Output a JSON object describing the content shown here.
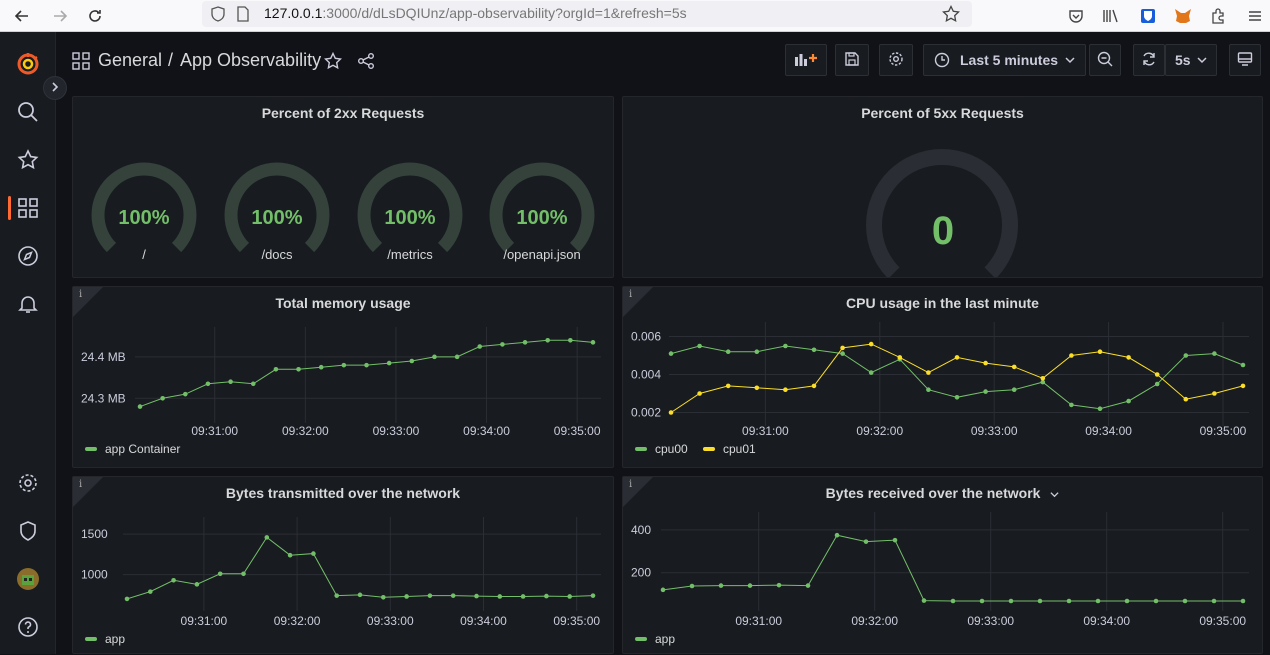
{
  "browser": {
    "url_scheme_host": "127.0.0.1",
    "url_rest": ":3000/d/dLsDQIUnz/app-observability?orgId=1&refresh=5s"
  },
  "header": {
    "folder": "General",
    "separator": "/",
    "title": "App Observability",
    "time_range": "Last 5 minutes",
    "refresh_interval": "5s"
  },
  "colors": {
    "green": "#73bf69",
    "yellow": "#fade2a",
    "accent": "#ff6a33"
  },
  "panels": {
    "p2xx": {
      "title": "Percent of 2xx Requests",
      "gauges": [
        {
          "value": "100%",
          "label": "/",
          "fraction": 1.0
        },
        {
          "value": "100%",
          "label": "/docs",
          "fraction": 1.0
        },
        {
          "value": "100%",
          "label": "/metrics",
          "fraction": 1.0
        },
        {
          "value": "100%",
          "label": "/openapi.json",
          "fraction": 1.0
        }
      ]
    },
    "p5xx": {
      "title": "Percent of 5xx Requests",
      "gauge": {
        "value": "0",
        "fraction": 0.0
      }
    },
    "memory": {
      "title": "Total memory usage",
      "info": "i"
    },
    "cpu": {
      "title": "CPU usage in the last minute",
      "info": "i"
    },
    "tx": {
      "title": "Bytes transmitted over the network",
      "info": "i"
    },
    "rx": {
      "title": "Bytes received over the network",
      "info": "i"
    }
  },
  "chart_data": [
    {
      "id": "memory",
      "type": "line",
      "title": "Total memory usage",
      "x_ticks": [
        "09:31:00",
        "09:32:00",
        "09:33:00",
        "09:34:00",
        "09:35:00"
      ],
      "y_ticks": [
        "24.3 MB",
        "24.4 MB"
      ],
      "ylim": [
        24.25,
        24.46
      ],
      "series": [
        {
          "name": "app Container",
          "color": "#73bf69",
          "values": [
            24.28,
            24.3,
            24.31,
            24.335,
            24.34,
            24.335,
            24.37,
            24.37,
            24.375,
            24.38,
            24.38,
            24.385,
            24.39,
            24.4,
            24.4,
            24.425,
            24.43,
            24.435,
            24.44,
            24.44,
            24.435
          ]
        }
      ]
    },
    {
      "id": "cpu",
      "type": "line",
      "title": "CPU usage in the last minute",
      "x_ticks": [
        "09:31:00",
        "09:32:00",
        "09:33:00",
        "09:34:00",
        "09:35:00"
      ],
      "y_ticks": [
        "0.002",
        "0.004",
        "0.006"
      ],
      "ylim": [
        0.0015,
        0.0065
      ],
      "series": [
        {
          "name": "cpu00",
          "color": "#73bf69",
          "values": [
            0.0051,
            0.0055,
            0.0052,
            0.0052,
            0.0055,
            0.0053,
            0.0051,
            0.0041,
            0.0048,
            0.0032,
            0.0028,
            0.0031,
            0.0032,
            0.0036,
            0.0024,
            0.0022,
            0.0026,
            0.0035,
            0.005,
            0.0051,
            0.0045
          ]
        },
        {
          "name": "cpu01",
          "color": "#fade2a",
          "values": [
            0.002,
            0.003,
            0.0034,
            0.0033,
            0.0032,
            0.0034,
            0.0054,
            0.0056,
            0.0049,
            0.0041,
            0.0049,
            0.0046,
            0.0044,
            0.0038,
            0.005,
            0.0052,
            0.0049,
            0.004,
            0.0027,
            0.003,
            0.0034
          ]
        }
      ]
    },
    {
      "id": "tx",
      "type": "line",
      "title": "Bytes transmitted over the network",
      "x_ticks": [
        "09:31:00",
        "09:32:00",
        "09:33:00",
        "09:34:00",
        "09:35:00"
      ],
      "y_ticks": [
        "1000",
        "1500"
      ],
      "ylim": [
        600,
        1650
      ],
      "series": [
        {
          "name": "app",
          "color": "#73bf69",
          "values": [
            700,
            790,
            930,
            880,
            1010,
            1010,
            1460,
            1240,
            1260,
            740,
            750,
            720,
            730,
            740,
            740,
            735,
            730,
            730,
            735,
            730,
            740
          ]
        }
      ]
    },
    {
      "id": "rx",
      "type": "line",
      "title": "Bytes received over the network",
      "x_ticks": [
        "09:31:00",
        "09:32:00",
        "09:33:00",
        "09:34:00",
        "09:35:00"
      ],
      "y_ticks": [
        "200",
        "400"
      ],
      "ylim": [
        40,
        460
      ],
      "series": [
        {
          "name": "app",
          "color": "#73bf69",
          "values": [
            120,
            138,
            140,
            140,
            142,
            140,
            375,
            345,
            352,
            70,
            68,
            68,
            68,
            68,
            68,
            68,
            68,
            68,
            68,
            68,
            68
          ]
        }
      ]
    }
  ]
}
